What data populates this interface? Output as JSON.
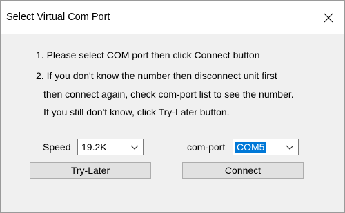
{
  "window": {
    "title": "Select Virtual Com Port",
    "close_glyph": "✕"
  },
  "instructions": {
    "line1": "1. Please select COM port then click Connect button",
    "line2": "2. If you don't know the number then disconnect unit first",
    "line3": "then connect again, check com-port list to see the number.",
    "line4": "If you still don't know, click Try-Later button."
  },
  "speed": {
    "label": "Speed",
    "value": "19.2K"
  },
  "comport": {
    "label": "com-port",
    "value": "COM5"
  },
  "buttons": {
    "try_later": "Try-Later",
    "connect": "Connect"
  },
  "colors": {
    "selection": "#0078d7",
    "button_face": "#e1e1e1",
    "dialog_bg": "#f0f0f0"
  }
}
